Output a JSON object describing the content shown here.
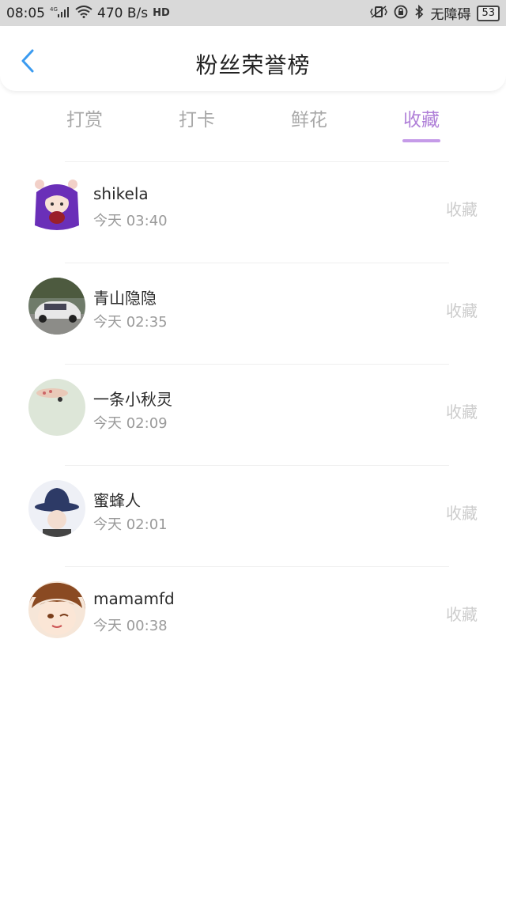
{
  "status_bar": {
    "time": "08:05",
    "network_type": "4G",
    "speed": "470 B/s",
    "hd": "HD",
    "accessibility": "无障碍",
    "battery": "53"
  },
  "header": {
    "title": "粉丝荣誉榜"
  },
  "tabs": [
    {
      "label": "打赏"
    },
    {
      "label": "打卡"
    },
    {
      "label": "鲜花"
    },
    {
      "label": "收藏"
    }
  ],
  "active_tab": "收藏",
  "colors": {
    "accent": "#b080d8",
    "back_arrow": "#3b9bf0"
  },
  "fans": [
    {
      "name": "shikela",
      "time": "今天 03:40",
      "action": "收藏"
    },
    {
      "name": "青山隐隐",
      "time": "今天 02:35",
      "action": "收藏"
    },
    {
      "name": "一条小秋灵",
      "time": "今天 02:09",
      "action": "收藏"
    },
    {
      "name": "蜜蜂人",
      "time": "今天 02:01",
      "action": "收藏"
    },
    {
      "name": "mamamfd",
      "time": "今天 00:38",
      "action": "收藏"
    }
  ]
}
